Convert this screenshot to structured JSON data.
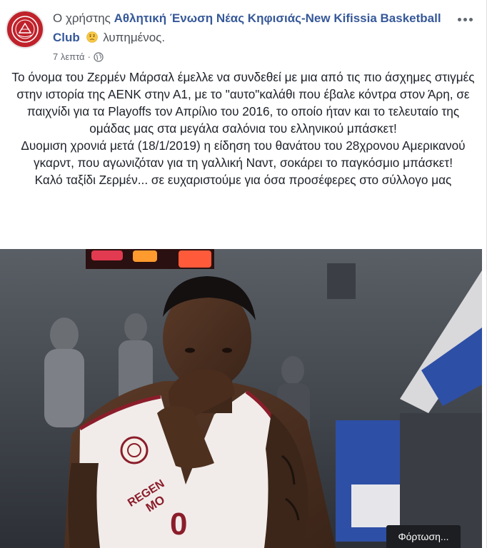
{
  "post": {
    "author_prefix": "Ο χρήστης",
    "page_name": "Αθλητική Ένωση Νέας Κηφισιάς-New Kifissia Basketball Club",
    "feeling": "λυπημένος.",
    "timestamp": "7 λεπτά",
    "privacy_icon": "globe-icon",
    "more_icon": "more-options-icon",
    "feeling_icon": "sad-face-emoji",
    "paragraphs": [
      "Το όνομα του Ζερμέν Μάρσαλ έμελλε να συνδεθεί με μια από τις πιο άσχημες στιγμές στην ιστορία της ΑΕΝΚ στην Α1, με το \"αυτο\"καλάθι που έβαλε κόντρα στον Άρη, σε παιχνίδι για τα Playoffs τον Απρίλιο του 2016, το οποίο ήταν και το τελευταίο της ομάδας μας στα μεγάλα σαλόνια του ελληνικού μπάσκετ!",
      "Δυομιση χρονιά μετά (18/1/2019) η είδηση του θανάτου του 28χρονου Αμερικανού γκαρντ, που αγωνιζόταν για τη γαλλική Ναντ, σοκάρει το παγκόσμιο μπάσκετ!",
      "Καλό ταξίδι Ζερμέν... σε ευχαριστούμε για όσα προσέφερες στο σύλλογο μας"
    ]
  },
  "photo": {
    "jersey_text_1": "REGEN",
    "jersey_text_2": "MO",
    "jersey_number": "0",
    "loading_label": "Φόρτωση..."
  },
  "colors": {
    "link": "#365899",
    "team_red": "#c0222b",
    "meta_gray": "#616770"
  }
}
